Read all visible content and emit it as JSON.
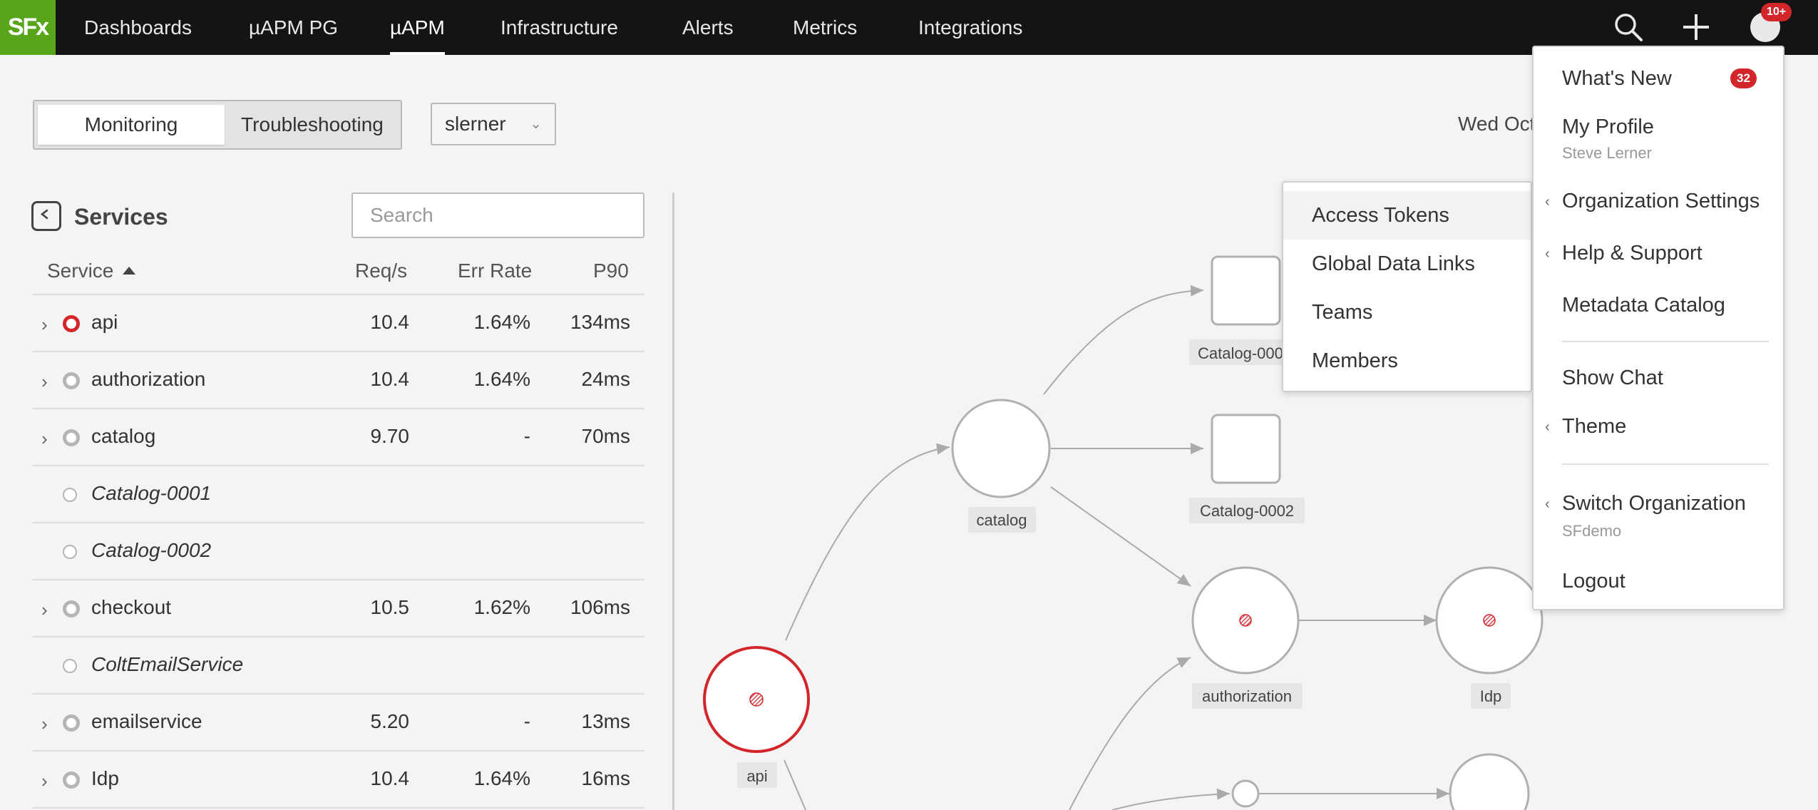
{
  "nav": {
    "logo": "SFx",
    "items": [
      {
        "label": "Dashboards",
        "active": false
      },
      {
        "label": "µAPM PG",
        "active": false
      },
      {
        "label": "µAPM",
        "active": true
      },
      {
        "label": "Infrastructure",
        "active": false
      },
      {
        "label": "Alerts",
        "active": false
      },
      {
        "label": "Metrics",
        "active": false
      },
      {
        "label": "Integrations",
        "active": false
      }
    ],
    "icons": [
      "search-icon",
      "plus-icon",
      "user-avatar-icon"
    ],
    "notification_badge": "10+"
  },
  "toolbar": {
    "tabs": [
      {
        "label": "Monitoring",
        "selected": true
      },
      {
        "label": "Troubleshooting",
        "selected": false
      }
    ],
    "environment": "slerner",
    "date_text": "Wed Oct"
  },
  "services": {
    "title": "Services",
    "search_placeholder": "Search",
    "columns": [
      "Service",
      "Req/s",
      "Err Rate",
      "P90"
    ],
    "rows": [
      {
        "name": "api",
        "req": "10.4",
        "err": "1.64%",
        "p90": "134ms",
        "status": "error",
        "expandable": true,
        "inferred": false
      },
      {
        "name": "authorization",
        "req": "10.4",
        "err": "1.64%",
        "p90": "24ms",
        "status": "ok",
        "expandable": true,
        "inferred": false
      },
      {
        "name": "catalog",
        "req": "9.70",
        "err": "-",
        "p90": "70ms",
        "status": "ok",
        "expandable": true,
        "inferred": false
      },
      {
        "name": "Catalog-0001",
        "req": "",
        "err": "",
        "p90": "",
        "status": "none",
        "expandable": false,
        "inferred": true
      },
      {
        "name": "Catalog-0002",
        "req": "",
        "err": "",
        "p90": "",
        "status": "none",
        "expandable": false,
        "inferred": true
      },
      {
        "name": "checkout",
        "req": "10.5",
        "err": "1.62%",
        "p90": "106ms",
        "status": "ok",
        "expandable": true,
        "inferred": false
      },
      {
        "name": "ColtEmailService",
        "req": "",
        "err": "",
        "p90": "",
        "status": "none",
        "expandable": false,
        "inferred": true
      },
      {
        "name": "emailservice",
        "req": "5.20",
        "err": "-",
        "p90": "13ms",
        "status": "ok",
        "expandable": true,
        "inferred": false
      },
      {
        "name": "Idp",
        "req": "10.4",
        "err": "1.64%",
        "p90": "16ms",
        "status": "ok",
        "expandable": true,
        "inferred": false
      }
    ]
  },
  "service_map": {
    "nodes": {
      "api": "api",
      "catalog": "catalog",
      "catalog_0001": "Catalog-0001",
      "catalog_0002": "Catalog-0002",
      "authorization": "authorization",
      "idp": "Idp"
    },
    "error_color": "#d3262b"
  },
  "user_menu": {
    "whats_new": "What's New",
    "whats_new_badge": "32",
    "my_profile": "My Profile",
    "user_name": "Steve Lerner",
    "org_settings": "Organization Settings",
    "help": "Help & Support",
    "metadata": "Metadata Catalog",
    "show_chat": "Show Chat",
    "theme": "Theme",
    "switch_org": "Switch Organization",
    "org_name": "SFdemo",
    "logout": "Logout"
  },
  "org_submenu": {
    "items": [
      "Access Tokens",
      "Global Data Links",
      "Teams",
      "Members"
    ]
  },
  "colors": {
    "brand": "#58a51c",
    "nav_bg": "#141414",
    "error": "#d3262b"
  }
}
